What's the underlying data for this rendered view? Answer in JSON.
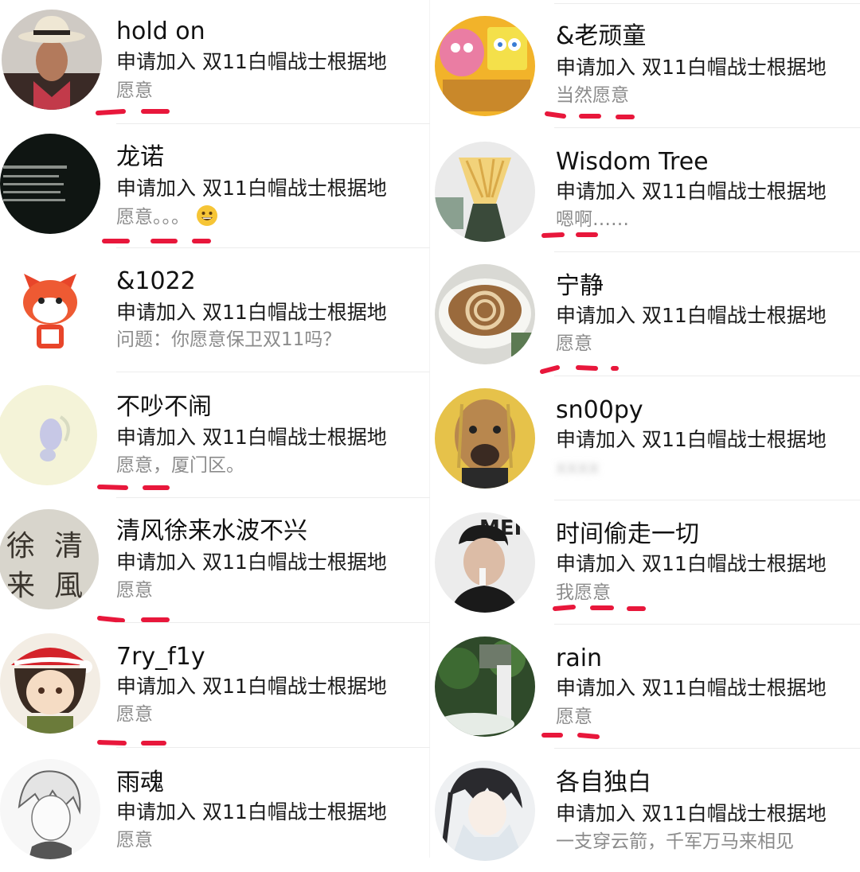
{
  "left_column": [
    {
      "name": "hold on",
      "request": "申请加入 双11白帽战士根据地",
      "answer": "愿意"
    },
    {
      "name": "龙诺",
      "request": "申请加入 双11白帽战士根据地",
      "answer": "愿意。。。",
      "emoji": "grinning-face"
    },
    {
      "name": "&1022",
      "request": "申请加入 双11白帽战士根据地",
      "answer": "问题：你愿意保卫双11吗？"
    },
    {
      "name": "不吵不闹",
      "request": "申请加入 双11白帽战士根据地",
      "answer": "愿意，厦门区。"
    },
    {
      "name": "清风徐来水波不兴",
      "request": "申请加入 双11白帽战士根据地",
      "answer": "愿意"
    },
    {
      "name": "7ry_f1y",
      "request": "申请加入 双11白帽战士根据地",
      "answer": "愿意"
    },
    {
      "name": "雨魂",
      "request": "申请加入 双11白帽战士根据地",
      "answer": "愿意"
    }
  ],
  "right_column": [
    {
      "name": "&老顽童",
      "request": "申请加入 双11白帽战士根据地",
      "answer": "当然愿意"
    },
    {
      "name": "Wisdom Tree",
      "request": "申请加入 双11白帽战士根据地",
      "answer": "嗯啊……"
    },
    {
      "name": "宁静",
      "request": "申请加入 双11白帽战士根据地",
      "answer": "愿意"
    },
    {
      "name": "sn00py",
      "request": "申请加入 双11白帽战士根据地",
      "answer": "xxxx"
    },
    {
      "name": "时间偷走一切",
      "request": "申请加入 双11白帽战士根据地",
      "answer": "我愿意"
    },
    {
      "name": "rain",
      "request": "申请加入 双11白帽战士根据地",
      "answer": "愿意"
    },
    {
      "name": "各自独白",
      "request": "申请加入 双11白帽战士根据地",
      "answer": "一支穿云箭，千军万马来相见"
    }
  ],
  "colors": {
    "underline": "#e8173b",
    "answer_text": "#8b8b8b",
    "name_text": "#111111"
  }
}
